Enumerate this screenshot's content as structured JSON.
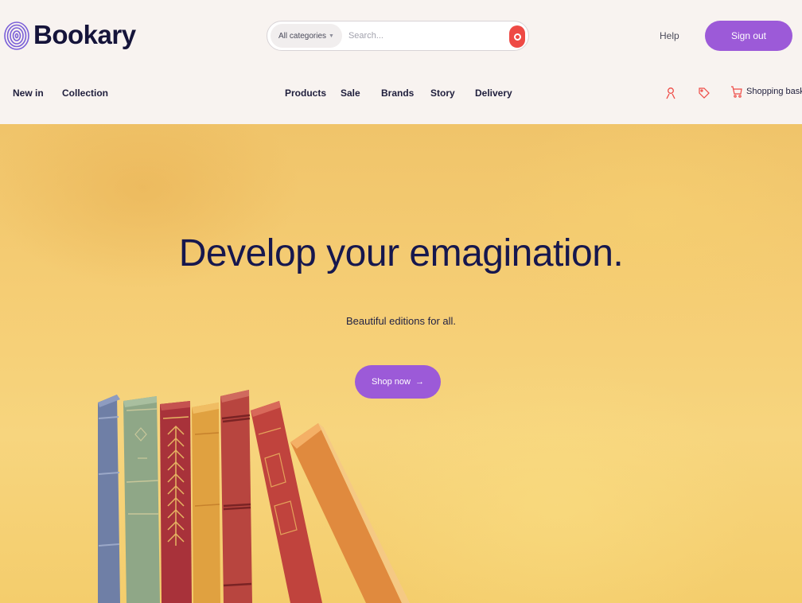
{
  "brand": {
    "name": "Bookary",
    "accent": "#9c5ad8",
    "search_color": "#ee4a45",
    "heading_color": "#16174e"
  },
  "search": {
    "category": "All categories",
    "placeholder": "Search..."
  },
  "header": {
    "help": "Help",
    "signout": "Sign out"
  },
  "nav": {
    "left": [
      "New in",
      "Collection"
    ],
    "center": [
      "Products",
      "Sale",
      "Brands",
      "Story",
      "Delivery"
    ],
    "basket": "Shopping basket"
  },
  "icons": {
    "logo": "fingerprint-logo-icon",
    "account": "user-icon",
    "tags": "tag-icon",
    "cart": "cart-icon",
    "search": "search-icon"
  },
  "hero": {
    "title": "Develop your emagination.",
    "subtitle": "Beautiful editions for all.",
    "cta": "Shop now",
    "cta_arrow": "→"
  }
}
